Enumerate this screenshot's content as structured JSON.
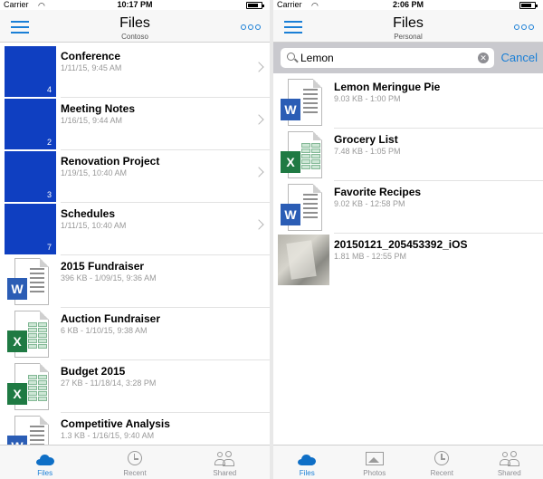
{
  "left": {
    "status": {
      "carrier": "Carrier",
      "time": "10:17 PM"
    },
    "nav": {
      "title": "Files",
      "subtitle": "Contoso"
    },
    "folders": [
      {
        "name": "Conference",
        "meta": "1/11/15, 9:45 AM",
        "count": "4"
      },
      {
        "name": "Meeting Notes",
        "meta": "1/16/15, 9:44 AM",
        "count": "2"
      },
      {
        "name": "Renovation Project",
        "meta": "1/19/15, 10:40 AM",
        "count": "3"
      },
      {
        "name": "Schedules",
        "meta": "1/11/15, 10:40 AM",
        "count": "7"
      }
    ],
    "files": [
      {
        "name": "2015 Fundraiser",
        "meta": "396 KB - 1/09/15, 9:36 AM",
        "kind": "word"
      },
      {
        "name": "Auction Fundraiser",
        "meta": "6 KB - 1/10/15, 9:38 AM",
        "kind": "excel"
      },
      {
        "name": "Budget 2015",
        "meta": "27 KB - 11/18/14, 3:28 PM",
        "kind": "excel"
      },
      {
        "name": "Competitive Analysis",
        "meta": "1.3 KB - 1/16/15, 9:40 AM",
        "kind": "word"
      }
    ],
    "tabs": [
      {
        "label": "Files",
        "icon": "cloud-icon",
        "active": true
      },
      {
        "label": "Recent",
        "icon": "clock-icon",
        "active": false
      },
      {
        "label": "Shared",
        "icon": "people-icon",
        "active": false
      }
    ]
  },
  "right": {
    "status": {
      "carrier": "Carrier",
      "time": "2:06 PM"
    },
    "nav": {
      "title": "Files",
      "subtitle": "Personal"
    },
    "search": {
      "value": "Lemon",
      "cancel_label": "Cancel"
    },
    "results": [
      {
        "name": "Lemon Meringue Pie",
        "meta": "9.03 KB - 1:00 PM",
        "kind": "word"
      },
      {
        "name": "Grocery List",
        "meta": "7.48 KB - 1:05 PM",
        "kind": "excel"
      },
      {
        "name": "Favorite Recipes",
        "meta": "9.02 KB - 12:58 PM",
        "kind": "word"
      },
      {
        "name": "20150121_205453392_iOS",
        "meta": "1.81 MB - 12:55 PM",
        "kind": "photo"
      }
    ],
    "tabs": [
      {
        "label": "Files",
        "icon": "cloud-icon",
        "active": true
      },
      {
        "label": "Photos",
        "icon": "photo-icon",
        "active": false
      },
      {
        "label": "Recent",
        "icon": "clock-icon",
        "active": false
      },
      {
        "label": "Shared",
        "icon": "people-icon",
        "active": false
      }
    ]
  },
  "colors": {
    "accent": "#1a7fd6",
    "folder": "#0f3fc1",
    "word": "#2b5db5",
    "excel": "#1f7a43"
  }
}
